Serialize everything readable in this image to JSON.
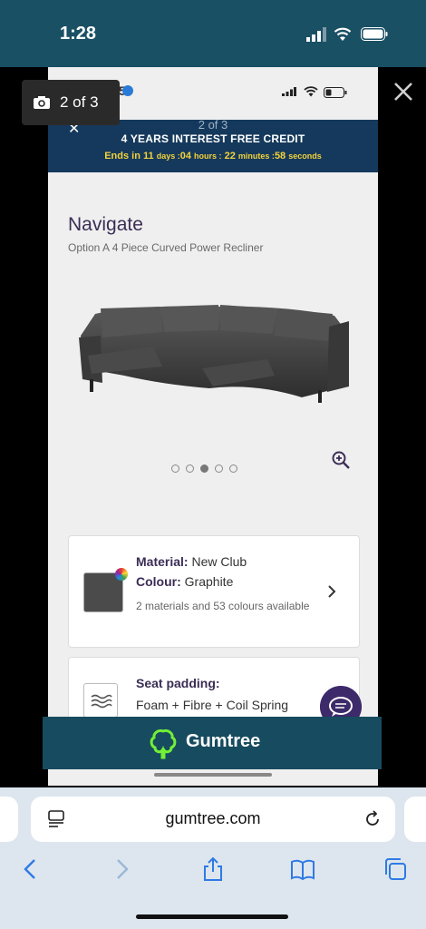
{
  "status": {
    "time": "1:28"
  },
  "viewer": {
    "counter": "2 of 3"
  },
  "inner": {
    "time": "17:35",
    "banner": {
      "page": "2 of 3",
      "headline": "4 YEARS INTEREST FREE CREDIT",
      "ends_in": "Ends in",
      "days_num": "11",
      "days": "days :",
      "hours_num": "04",
      "hours": "hours :",
      "minutes_num": "22",
      "minutes": "minutes :",
      "seconds_num": "58",
      "seconds": "seconds"
    },
    "product": {
      "title": "Navigate",
      "subtitle": "Option A 4 Piece Curved Power Recliner"
    },
    "gallery": {
      "dots": 5,
      "active_dot": 3
    },
    "material_card": {
      "material_label": "Material:",
      "material_value": "New Club",
      "colour_label": "Colour:",
      "colour_value": "Graphite",
      "availability": "2 materials and 53 colours available",
      "swatch_color": "#4b4b4b"
    },
    "padding_card": {
      "label": "Seat padding:",
      "value": "Foam + Fibre + Coil Spring"
    },
    "gumtree": {
      "brand": "Gumtree",
      "brand_color": "#72ef36"
    }
  },
  "safari": {
    "url": "gumtree.com"
  }
}
